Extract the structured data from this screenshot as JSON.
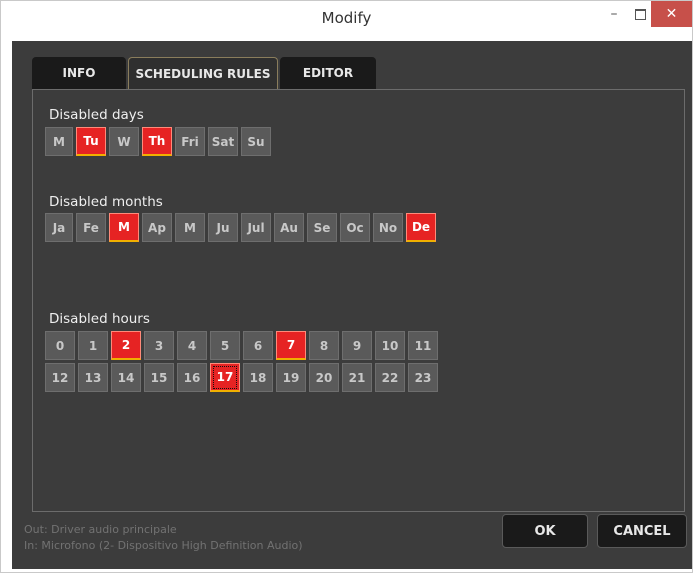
{
  "window": {
    "title": "Modify",
    "minimize_glyph": "–",
    "close_glyph": "✕"
  },
  "tabs": [
    {
      "label": "INFO",
      "active": false
    },
    {
      "label": "SCHEDULING RULES",
      "active": true
    },
    {
      "label": "EDITOR",
      "active": false
    }
  ],
  "disabled_days": {
    "label": "Disabled days",
    "items": [
      {
        "label": "M",
        "on": false
      },
      {
        "label": "Tu",
        "on": true
      },
      {
        "label": "W",
        "on": false
      },
      {
        "label": "Th",
        "on": true
      },
      {
        "label": "Fri",
        "on": false
      },
      {
        "label": "Sat",
        "on": false
      },
      {
        "label": "Su",
        "on": false
      }
    ]
  },
  "disabled_months": {
    "label": "Disabled months",
    "items": [
      {
        "label": "Ja",
        "on": false
      },
      {
        "label": "Fe",
        "on": false
      },
      {
        "label": "M",
        "on": true
      },
      {
        "label": "Ap",
        "on": false
      },
      {
        "label": "M",
        "on": false
      },
      {
        "label": "Ju",
        "on": false
      },
      {
        "label": "Jul",
        "on": false
      },
      {
        "label": "Au",
        "on": false
      },
      {
        "label": "Se",
        "on": false
      },
      {
        "label": "Oc",
        "on": false
      },
      {
        "label": "No",
        "on": false
      },
      {
        "label": "De",
        "on": true
      }
    ]
  },
  "disabled_hours": {
    "label": "Disabled hours",
    "rows": [
      [
        {
          "label": "0",
          "on": false
        },
        {
          "label": "1",
          "on": false
        },
        {
          "label": "2",
          "on": true
        },
        {
          "label": "3",
          "on": false
        },
        {
          "label": "4",
          "on": false
        },
        {
          "label": "5",
          "on": false
        },
        {
          "label": "6",
          "on": false
        },
        {
          "label": "7",
          "on": true
        },
        {
          "label": "8",
          "on": false
        },
        {
          "label": "9",
          "on": false
        },
        {
          "label": "10",
          "on": false
        },
        {
          "label": "11",
          "on": false
        }
      ],
      [
        {
          "label": "12",
          "on": false
        },
        {
          "label": "13",
          "on": false
        },
        {
          "label": "14",
          "on": false
        },
        {
          "label": "15",
          "on": false
        },
        {
          "label": "16",
          "on": false
        },
        {
          "label": "17",
          "on": true,
          "focused": true
        },
        {
          "label": "18",
          "on": false
        },
        {
          "label": "19",
          "on": false
        },
        {
          "label": "20",
          "on": false
        },
        {
          "label": "21",
          "on": false
        },
        {
          "label": "22",
          "on": false
        },
        {
          "label": "23",
          "on": false
        }
      ]
    ]
  },
  "footer": {
    "out_text": "Out: Driver audio principale",
    "in_text": "In: Microfono (2- Dispositivo High Definition Audio)",
    "ok_label": "OK",
    "cancel_label": "CANCEL"
  },
  "colors": {
    "accent_on": "#e62323",
    "accent_border": "#f0b000",
    "background": "#3c3c3c",
    "button_off": "#5a5a5a",
    "close_button": "#c7504a"
  }
}
